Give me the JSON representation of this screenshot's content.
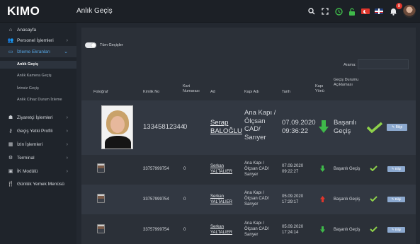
{
  "app": {
    "logo": "KIMO",
    "page_title": "Anlık Geçiş"
  },
  "topbar": {
    "icons": [
      "search-icon",
      "fullscreen-icon",
      "clock-icon",
      "lock-icon",
      "flag-tr-icon",
      "flag-uk-icon",
      "bell-icon",
      "user-avatar"
    ],
    "notification_count": "8"
  },
  "sidebar": {
    "items": [
      {
        "label": "Anasayfa",
        "icon": "home-icon",
        "has_children": false
      },
      {
        "label": "Personel İşlemleri",
        "icon": "people-icon",
        "has_children": true
      },
      {
        "label": "İzleme Ekranları",
        "icon": "monitor-icon",
        "has_children": true,
        "open": true
      },
      {
        "label": "Ziyaretçi İşlemleri",
        "icon": "visitor-icon",
        "has_children": true
      },
      {
        "label": "Geçiş Yetki Profili",
        "icon": "key-icon",
        "has_children": true
      },
      {
        "label": "İzin İşlemleri",
        "icon": "calendar-icon",
        "has_children": true
      },
      {
        "label": "Terminal",
        "icon": "gear-icon",
        "has_children": true
      },
      {
        "label": "İK Modülü",
        "icon": "hr-icon",
        "has_children": true
      },
      {
        "label": "Günlük Yemek Menüsü",
        "icon": "food-icon",
        "has_children": false
      }
    ],
    "sub_items": [
      "Anlık Geçiş",
      "Anlık Kamera Geçiş",
      "İzinsiz Geçiş",
      "Anlık Cihaz Durum İzleme"
    ],
    "active_sub": "Anlık Geçiş"
  },
  "filters": {
    "toggle_label": "Tüm Geçişler",
    "search_label": "Arama:",
    "search_value": ""
  },
  "table": {
    "columns": [
      "Fotoğraf",
      "Kimlik No",
      "Kart Numarası",
      "Ad",
      "Kapı Adı",
      "Tarih",
      "Kapı Yönü",
      "Geçiş Durumu Açıklaması"
    ],
    "rows": [
      {
        "kimlik_no": "13345812344",
        "kart_no": "0",
        "ad": "Serap BALOĞLU",
        "kapi_adi": "Ana Kapı / Ölçsan CAD/ Sarıyer",
        "tarih": "07.09.2020 09:36:22",
        "yon": "in",
        "durum": "Başarılı Geçiş",
        "button": "Bilgi"
      },
      {
        "kimlik_no": "33757999754",
        "kart_no": "0",
        "ad": "Serkan YALTALIER",
        "kapi_adi": "Ana Kapı / Ölçsan CAD/ Sarıyer",
        "tarih": "07.09.2020 09:22:27",
        "yon": "in",
        "durum": "Başarılı Geçiş",
        "button": "Bilgi"
      },
      {
        "kimlik_no": "33757999754",
        "kart_no": "0",
        "ad": "Serkan YALTALIER",
        "kapi_adi": "Ana Kapı / Ölçsan CAD/ Sarıyer",
        "tarih": "05.09.2020 17:29:17",
        "yon": "out",
        "durum": "Başarılı Geçiş",
        "button": "Bilgi"
      },
      {
        "kimlik_no": "33757999754",
        "kart_no": "0",
        "ad": "Serkan YALTALIER",
        "kapi_adi": "Ana Kapı / Ölçsan CAD/ Sarıyer",
        "tarih": "05.09.2020 17:24:14",
        "yon": "in",
        "durum": "Başarılı Geçiş",
        "button": "Bilgi"
      }
    ]
  },
  "colors": {
    "in": "#3fb94a",
    "out": "#e0362c",
    "success_check": "#8ed14a",
    "accent": "#57a9e8",
    "info_button": "#8ca9cf"
  }
}
